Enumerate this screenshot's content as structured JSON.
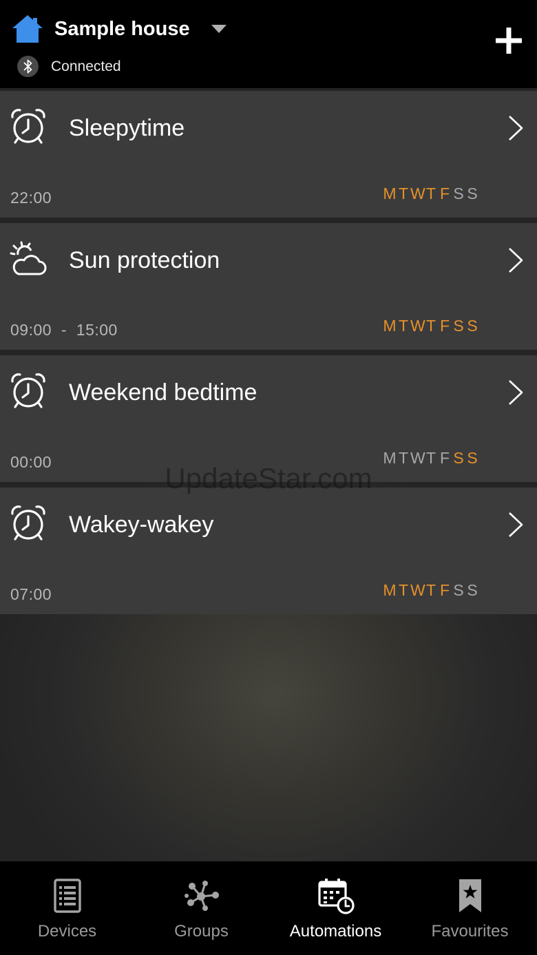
{
  "header": {
    "house_name": "Sample house",
    "status": "Connected"
  },
  "colors": {
    "accent_orange": "#e5912b",
    "home_blue": "#3d8fe9",
    "card_background": "#3b3b3c"
  },
  "automations": [
    {
      "icon": "alarm-clock-icon",
      "title": "Sleepytime",
      "time": "22:00",
      "days": [
        "M",
        "T",
        "W",
        "T",
        "F",
        "S",
        "S"
      ],
      "active": [
        true,
        true,
        true,
        true,
        true,
        false,
        false
      ]
    },
    {
      "icon": "sun-cloud-icon",
      "title": "Sun protection",
      "time": "09:00  -  15:00",
      "days": [
        "M",
        "T",
        "W",
        "T",
        "F",
        "S",
        "S"
      ],
      "active": [
        true,
        true,
        true,
        true,
        true,
        true,
        true
      ]
    },
    {
      "icon": "alarm-clock-icon",
      "title": "Weekend bedtime",
      "time": "00:00",
      "days": [
        "M",
        "T",
        "W",
        "T",
        "F",
        "S",
        "S"
      ],
      "active": [
        false,
        false,
        false,
        false,
        false,
        true,
        true
      ]
    },
    {
      "icon": "alarm-clock-icon",
      "title": "Wakey-wakey",
      "time": "07:00",
      "days": [
        "M",
        "T",
        "W",
        "T",
        "F",
        "S",
        "S"
      ],
      "active": [
        true,
        true,
        true,
        true,
        true,
        false,
        false
      ]
    }
  ],
  "watermark": "UpdateStar.com",
  "tabs": [
    {
      "label": "Devices",
      "icon": "devices-list-icon",
      "active": false
    },
    {
      "label": "Groups",
      "icon": "groups-network-icon",
      "active": false
    },
    {
      "label": "Automations",
      "icon": "calendar-clock-icon",
      "active": true
    },
    {
      "label": "Favourites",
      "icon": "bookmark-star-icon",
      "active": false
    }
  ]
}
